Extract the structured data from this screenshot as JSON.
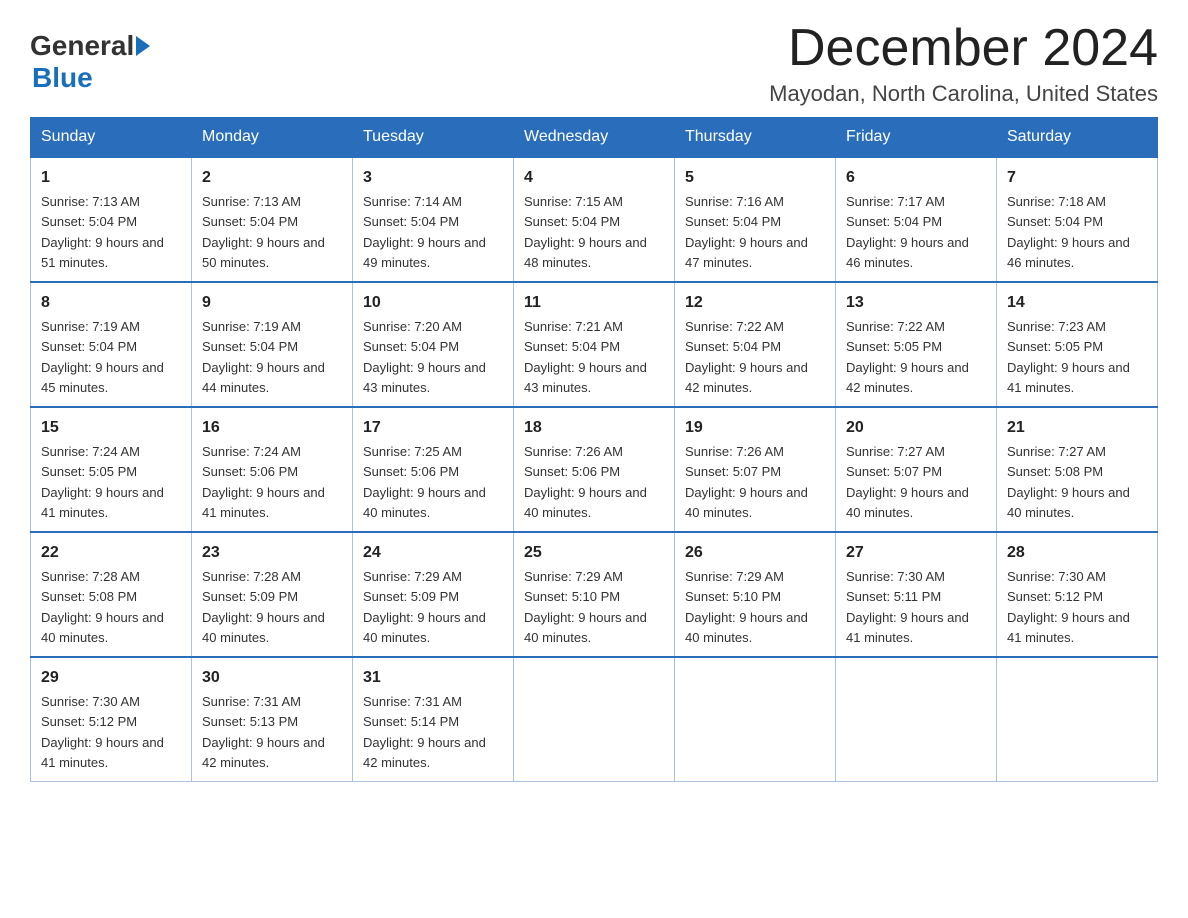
{
  "logo": {
    "general": "General",
    "blue": "Blue"
  },
  "title": "December 2024",
  "location": "Mayodan, North Carolina, United States",
  "headers": [
    "Sunday",
    "Monday",
    "Tuesday",
    "Wednesday",
    "Thursday",
    "Friday",
    "Saturday"
  ],
  "weeks": [
    [
      {
        "day": "1",
        "sunrise": "7:13 AM",
        "sunset": "5:04 PM",
        "daylight": "9 hours and 51 minutes."
      },
      {
        "day": "2",
        "sunrise": "7:13 AM",
        "sunset": "5:04 PM",
        "daylight": "9 hours and 50 minutes."
      },
      {
        "day": "3",
        "sunrise": "7:14 AM",
        "sunset": "5:04 PM",
        "daylight": "9 hours and 49 minutes."
      },
      {
        "day": "4",
        "sunrise": "7:15 AM",
        "sunset": "5:04 PM",
        "daylight": "9 hours and 48 minutes."
      },
      {
        "day": "5",
        "sunrise": "7:16 AM",
        "sunset": "5:04 PM",
        "daylight": "9 hours and 47 minutes."
      },
      {
        "day": "6",
        "sunrise": "7:17 AM",
        "sunset": "5:04 PM",
        "daylight": "9 hours and 46 minutes."
      },
      {
        "day": "7",
        "sunrise": "7:18 AM",
        "sunset": "5:04 PM",
        "daylight": "9 hours and 46 minutes."
      }
    ],
    [
      {
        "day": "8",
        "sunrise": "7:19 AM",
        "sunset": "5:04 PM",
        "daylight": "9 hours and 45 minutes."
      },
      {
        "day": "9",
        "sunrise": "7:19 AM",
        "sunset": "5:04 PM",
        "daylight": "9 hours and 44 minutes."
      },
      {
        "day": "10",
        "sunrise": "7:20 AM",
        "sunset": "5:04 PM",
        "daylight": "9 hours and 43 minutes."
      },
      {
        "day": "11",
        "sunrise": "7:21 AM",
        "sunset": "5:04 PM",
        "daylight": "9 hours and 43 minutes."
      },
      {
        "day": "12",
        "sunrise": "7:22 AM",
        "sunset": "5:04 PM",
        "daylight": "9 hours and 42 minutes."
      },
      {
        "day": "13",
        "sunrise": "7:22 AM",
        "sunset": "5:05 PM",
        "daylight": "9 hours and 42 minutes."
      },
      {
        "day": "14",
        "sunrise": "7:23 AM",
        "sunset": "5:05 PM",
        "daylight": "9 hours and 41 minutes."
      }
    ],
    [
      {
        "day": "15",
        "sunrise": "7:24 AM",
        "sunset": "5:05 PM",
        "daylight": "9 hours and 41 minutes."
      },
      {
        "day": "16",
        "sunrise": "7:24 AM",
        "sunset": "5:06 PM",
        "daylight": "9 hours and 41 minutes."
      },
      {
        "day": "17",
        "sunrise": "7:25 AM",
        "sunset": "5:06 PM",
        "daylight": "9 hours and 40 minutes."
      },
      {
        "day": "18",
        "sunrise": "7:26 AM",
        "sunset": "5:06 PM",
        "daylight": "9 hours and 40 minutes."
      },
      {
        "day": "19",
        "sunrise": "7:26 AM",
        "sunset": "5:07 PM",
        "daylight": "9 hours and 40 minutes."
      },
      {
        "day": "20",
        "sunrise": "7:27 AM",
        "sunset": "5:07 PM",
        "daylight": "9 hours and 40 minutes."
      },
      {
        "day": "21",
        "sunrise": "7:27 AM",
        "sunset": "5:08 PM",
        "daylight": "9 hours and 40 minutes."
      }
    ],
    [
      {
        "day": "22",
        "sunrise": "7:28 AM",
        "sunset": "5:08 PM",
        "daylight": "9 hours and 40 minutes."
      },
      {
        "day": "23",
        "sunrise": "7:28 AM",
        "sunset": "5:09 PM",
        "daylight": "9 hours and 40 minutes."
      },
      {
        "day": "24",
        "sunrise": "7:29 AM",
        "sunset": "5:09 PM",
        "daylight": "9 hours and 40 minutes."
      },
      {
        "day": "25",
        "sunrise": "7:29 AM",
        "sunset": "5:10 PM",
        "daylight": "9 hours and 40 minutes."
      },
      {
        "day": "26",
        "sunrise": "7:29 AM",
        "sunset": "5:10 PM",
        "daylight": "9 hours and 40 minutes."
      },
      {
        "day": "27",
        "sunrise": "7:30 AM",
        "sunset": "5:11 PM",
        "daylight": "9 hours and 41 minutes."
      },
      {
        "day": "28",
        "sunrise": "7:30 AM",
        "sunset": "5:12 PM",
        "daylight": "9 hours and 41 minutes."
      }
    ],
    [
      {
        "day": "29",
        "sunrise": "7:30 AM",
        "sunset": "5:12 PM",
        "daylight": "9 hours and 41 minutes."
      },
      {
        "day": "30",
        "sunrise": "7:31 AM",
        "sunset": "5:13 PM",
        "daylight": "9 hours and 42 minutes."
      },
      {
        "day": "31",
        "sunrise": "7:31 AM",
        "sunset": "5:14 PM",
        "daylight": "9 hours and 42 minutes."
      },
      null,
      null,
      null,
      null
    ]
  ]
}
